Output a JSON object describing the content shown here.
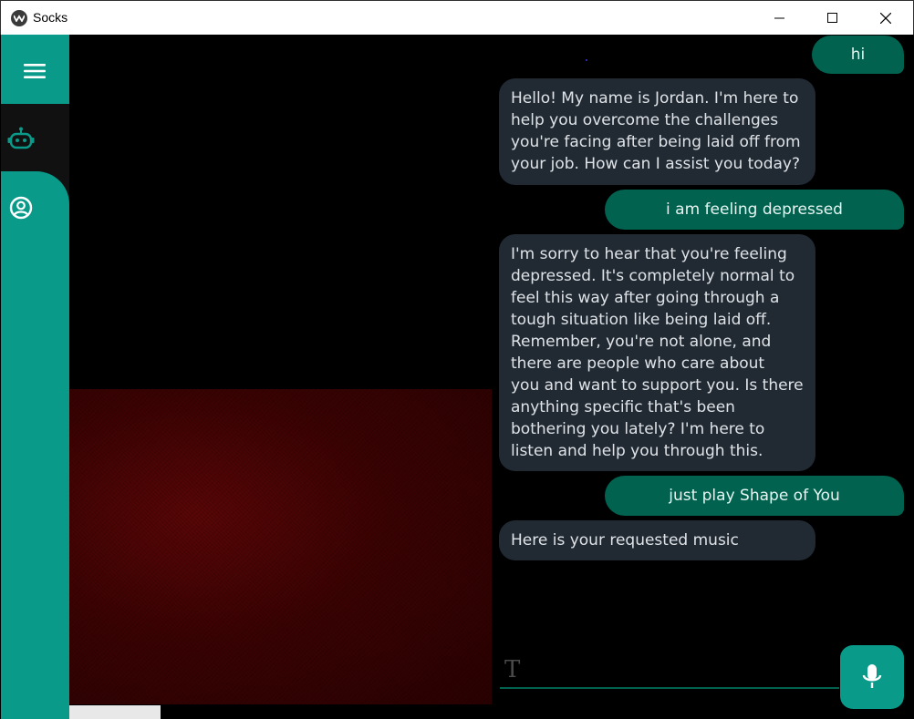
{
  "window": {
    "title": "Socks"
  },
  "sidebar": {
    "items": [
      {
        "name": "menu",
        "icon": "hamburger-menu-icon"
      },
      {
        "name": "bot",
        "icon": "robot-icon",
        "active": true
      },
      {
        "name": "profile",
        "icon": "user-circle-icon"
      }
    ]
  },
  "chat": {
    "messages": [
      {
        "role": "user",
        "text": "hi"
      },
      {
        "role": "bot",
        "text": "Hello! My name is Jordan. I'm here to\nhelp you overcome the challenges\nyou're facing after being laid off from\nyour job. How can I assist you today?"
      },
      {
        "role": "user",
        "text": "i am feeling depressed"
      },
      {
        "role": "bot",
        "text": "I'm sorry to hear that you're feeling\ndepressed. It's completely normal to\nfeel this way after going through a\ntough situation like being laid off.\nRemember, you're not alone, and\nthere are people who care about\nyou and want to support you. Is there\nanything specific that's been\nbothering you lately? I'm here to\nlisten and help you through this."
      },
      {
        "role": "user",
        "text": "just play Shape of You"
      },
      {
        "role": "bot",
        "text": "Here is your requested music"
      }
    ]
  },
  "input": {
    "value": "",
    "placeholder": ""
  },
  "colors": {
    "accent": "#0a9a8a",
    "user_bubble": "#00624f",
    "bot_bubble": "#212a33",
    "background": "#000000"
  }
}
